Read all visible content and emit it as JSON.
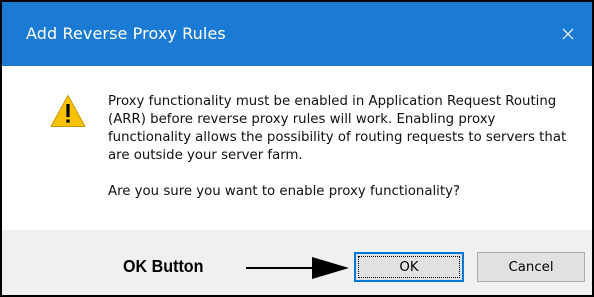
{
  "dialog": {
    "title": "Add Reverse Proxy Rules",
    "close_icon": "close-icon",
    "warning_icon": "warning-icon",
    "message": "Proxy functionality must be enabled in Application Request Routing (ARR) before reverse proxy rules will work. Enabling proxy functionality allows the possibility of routing requests to servers that are outside your server farm.",
    "question": "Are you sure you want to enable proxy functionality?"
  },
  "annotation": {
    "label": "OK Button"
  },
  "buttons": {
    "ok": "OK",
    "cancel": "Cancel"
  },
  "colors": {
    "titlebar": "#1a7ad4",
    "footer": "#f0f0f0",
    "warning_yellow": "#f7c300"
  }
}
